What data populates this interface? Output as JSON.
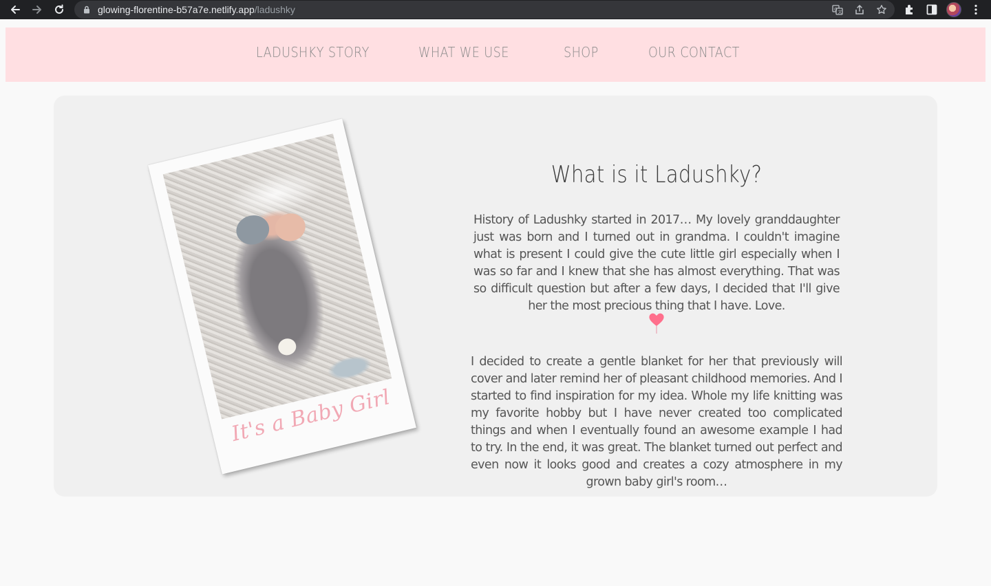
{
  "browser": {
    "url_host": "glowing-florentine-b57a7e.netlify.app",
    "url_path": "/ladushky",
    "icons": [
      "back-arrow-icon",
      "forward-arrow-icon",
      "reload-icon",
      "lock-icon",
      "translate-icon",
      "share-icon",
      "star-icon",
      "extensions-icon",
      "sidebar-icon",
      "avatar",
      "more-icon"
    ]
  },
  "nav": {
    "items": [
      {
        "label": "LADUSHKY STORY"
      },
      {
        "label": "WHAT WE USE"
      },
      {
        "label": "SHOP"
      },
      {
        "label": "OUR CONTACT"
      }
    ]
  },
  "colors": {
    "header_bg": "#ffdfe2",
    "card_bg": "#f0f0f0",
    "heart": "#ff6f8c",
    "caption": "#f1a8b4"
  },
  "main": {
    "photo_caption": "It's a Baby Girl",
    "heading": "What is it Ladushky?",
    "paragraph_1": "History of Ladushky started in 2017… My lovely granddaughter just was born and I turned out in grandma. I couldn't imagine what is present I could give the cute little girl especially when I was so far and I knew that she has almost everything. That was so difficult question but after a few days, I decided that I'll give her the most precious thing that I have. Love.",
    "paragraph_2": "I decided to create a gentle blanket for her that previously will cover and later remind her of pleasant childhood memories. And I started to find inspiration for my idea.  Whole my life knitting was my favorite hobby but I have never created too complicated things and when I eventually found an awesome example I had to try. In the end, it was great. The blanket turned out perfect and even now it looks good and creates a cozy atmosphere in my grown baby girl's room…",
    "divider_icon": "heart-balloon-icon"
  }
}
